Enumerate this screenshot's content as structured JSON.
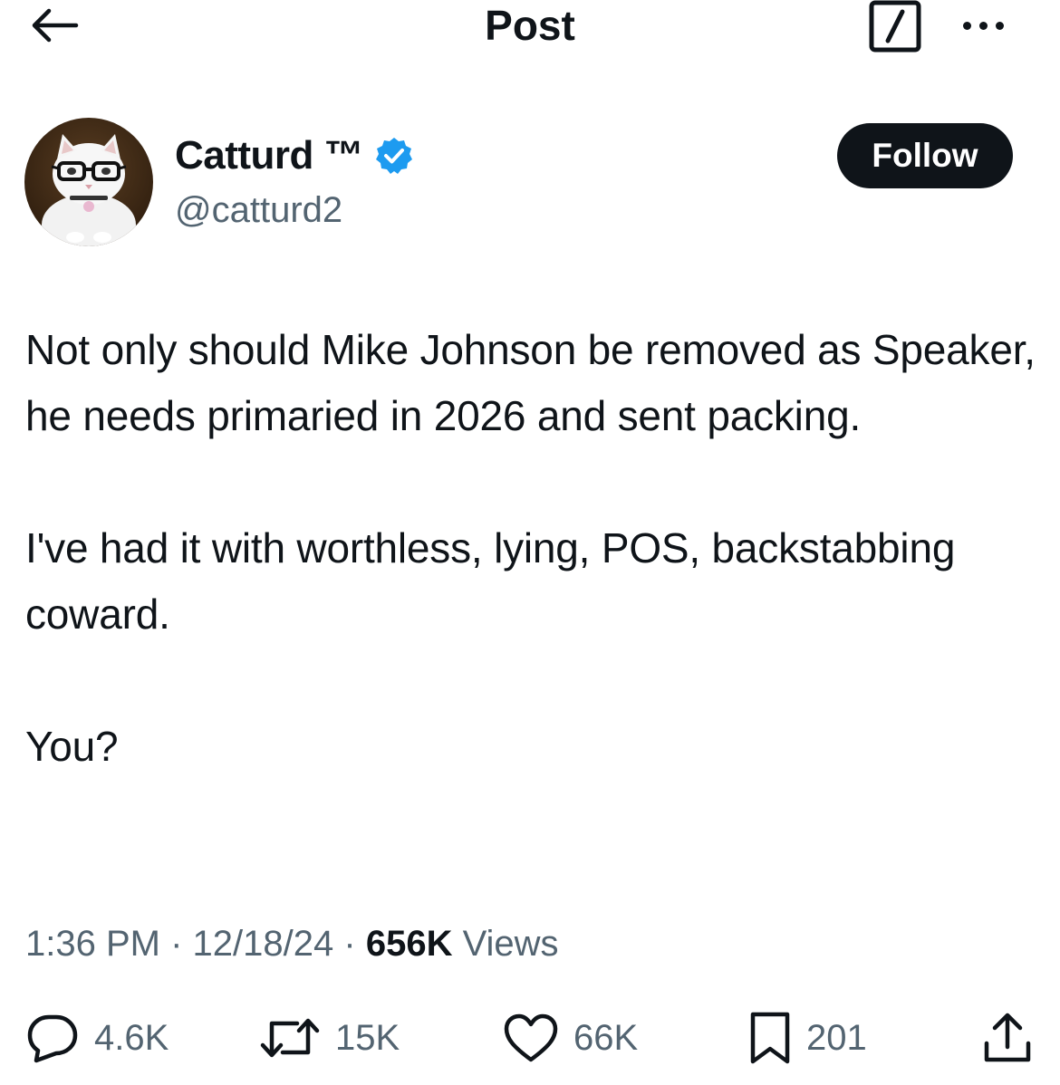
{
  "header": {
    "title": "Post",
    "back_icon": "arrow-left-icon",
    "grok_icon": "grok-icon",
    "more_icon": "more-horizontal-icon"
  },
  "author": {
    "display_name": "Catturd ™",
    "handle": "@catturd2",
    "verified": true,
    "verified_color": "#1d9bf0",
    "follow_label": "Follow"
  },
  "tweet": {
    "paragraphs": [
      "Not only should Mike Johnson be removed as Speaker, he needs primaried in 2026 and sent packing.",
      "I've had it with worthless, lying, POS, backstabbing coward.",
      "You?"
    ]
  },
  "meta": {
    "time": "1:36 PM",
    "date": "12/18/24",
    "separator": "·",
    "views_count": "656K",
    "views_label": "Views"
  },
  "actions": {
    "replies": "4.6K",
    "reposts": "15K",
    "likes": "66K",
    "bookmarks": "201"
  },
  "colors": {
    "text": "#0f1419",
    "secondary": "#536471",
    "accent": "#1d9bf0",
    "button_bg": "#0f1419"
  }
}
